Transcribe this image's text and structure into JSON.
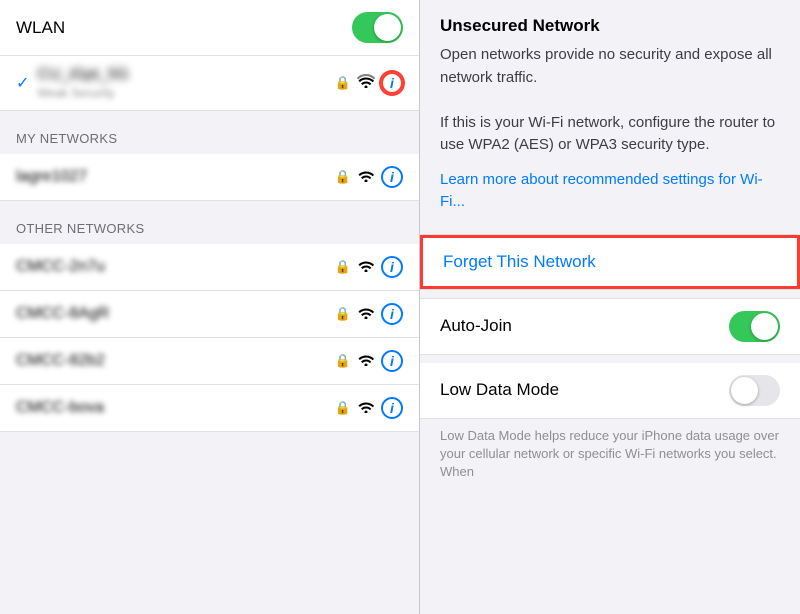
{
  "left": {
    "wlan_label": "WLAN",
    "connected_network_name": "CU_iGpt_5G",
    "connected_network_sub": "Weak Security",
    "my_networks_header": "MY NETWORKS",
    "my_network_1": "lagre1027",
    "other_networks_header": "OTHER NETWORKS",
    "other_networks": [
      "CMCC-2n7u",
      "CMCC-8AgR",
      "CMCC-82b2",
      "CMCC-bova"
    ]
  },
  "right": {
    "unsecured_title": "Unsecured Network",
    "unsecured_body_1": "Open networks provide no security and expose all network traffic.",
    "unsecured_body_2": "If this is your Wi-Fi network, configure the router to use WPA2 (AES) or WPA3 security type.",
    "learn_more": "Learn more about recommended settings for Wi-Fi...",
    "forget_label": "Forget This Network",
    "auto_join_label": "Auto-Join",
    "low_data_label": "Low Data Mode",
    "low_data_desc": "Low Data Mode helps reduce your iPhone data usage over your cellular network or specific Wi-Fi networks you select. When"
  }
}
